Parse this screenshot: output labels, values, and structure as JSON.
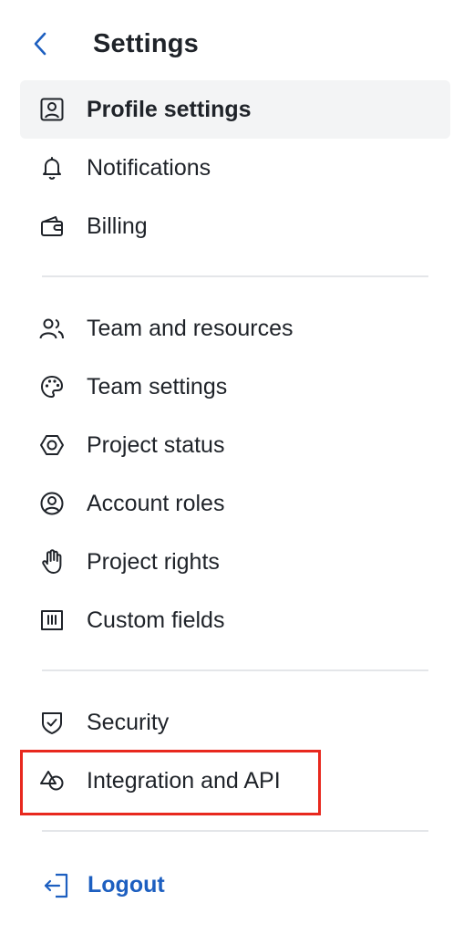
{
  "header": {
    "title": "Settings"
  },
  "menu": {
    "items": [
      {
        "label": "Profile settings",
        "icon": "user-profile-icon",
        "active": true
      },
      {
        "label": "Notifications",
        "icon": "bell-icon"
      },
      {
        "label": "Billing",
        "icon": "wallet-icon"
      },
      {
        "label": "Team and resources",
        "icon": "users-icon"
      },
      {
        "label": "Team settings",
        "icon": "palette-icon"
      },
      {
        "label": "Project status",
        "icon": "hexagon-icon"
      },
      {
        "label": "Account roles",
        "icon": "user-circle-icon"
      },
      {
        "label": "Project rights",
        "icon": "hand-icon"
      },
      {
        "label": "Custom fields",
        "icon": "custom-fields-icon"
      },
      {
        "label": "Security",
        "icon": "shield-check-icon"
      },
      {
        "label": "Integration and API",
        "icon": "shapes-icon",
        "highlighted": true
      }
    ]
  },
  "logout": {
    "label": "Logout",
    "icon": "logout-icon"
  },
  "colors": {
    "accent": "#1d5fc0",
    "highlight": "#e8281e",
    "active_bg": "#f3f4f5",
    "divider": "#e4e6e9"
  }
}
